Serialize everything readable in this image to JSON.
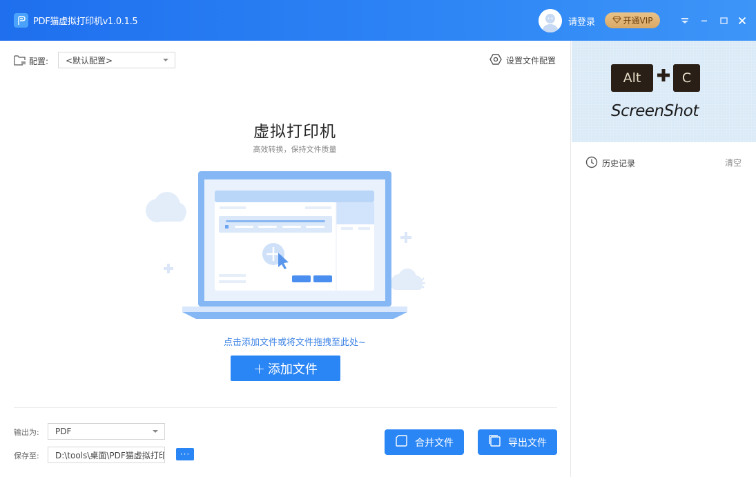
{
  "titlebar": {
    "app_title": "PDF猫虚拟打印机v1.0.1.5",
    "login_label": "请登录",
    "vip_label": "开通VIP",
    "icons": [
      "app-logo-icon",
      "avatar",
      "diamond-icon",
      "menu-dropdown-icon",
      "minimize-icon",
      "maximize-icon",
      "close-icon"
    ]
  },
  "config": {
    "label": "配置:",
    "selected": "<默认配置>",
    "file_config_label": "设置文件配置"
  },
  "hero": {
    "title": "虚拟打印机",
    "subtitle": "高效转换，保持文件质量",
    "hint": "点击添加文件或将文件拖拽至此处~",
    "add_button": "添加文件",
    "add_button_icon": "+"
  },
  "output": {
    "format_label": "输出为:",
    "format_value": "PDF",
    "save_label": "保存至:",
    "save_path": "D:\\tools\\桌面\\PDF猫虚拟打印机",
    "browse_button": "···"
  },
  "actions": {
    "merge_label": "合并文件",
    "export_label": "导出文件"
  },
  "sidebar": {
    "banner": {
      "key1": "Alt",
      "plus": "+",
      "key2": "C",
      "caption": "ScreenShot"
    },
    "history_label": "历史记录",
    "clear_label": "清空"
  },
  "colors": {
    "primary": "#2a86f5",
    "titlebar": "#2e86f5",
    "vip_gold": "#e0b677",
    "banner_bg": "#dbeaf7"
  }
}
